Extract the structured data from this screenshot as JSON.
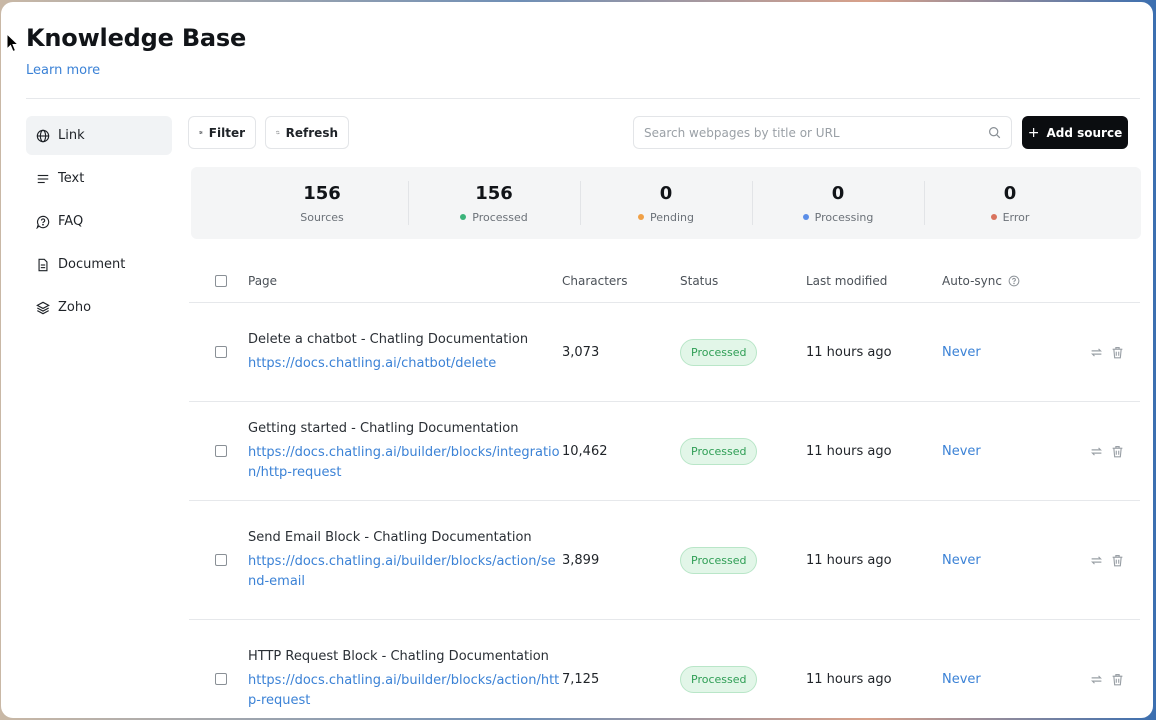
{
  "header": {
    "title": "Knowledge Base",
    "learn_more": "Learn more"
  },
  "sidebar": {
    "items": [
      {
        "label": "Link",
        "icon": "globe-icon",
        "active": true
      },
      {
        "label": "Text",
        "icon": "text-lines-icon"
      },
      {
        "label": "FAQ",
        "icon": "help-chat-icon"
      },
      {
        "label": "Document",
        "icon": "document-icon"
      },
      {
        "label": "Zoho",
        "icon": "layers-icon"
      }
    ]
  },
  "toolbar": {
    "filter_label": "Filter",
    "refresh_label": "Refresh",
    "search_placeholder": "Search webpages by title or URL",
    "add_source_label": "Add source"
  },
  "stats": [
    {
      "value": "156",
      "label": "Sources"
    },
    {
      "value": "156",
      "label": "Processed",
      "color": "#3bb37a"
    },
    {
      "value": "0",
      "label": "Pending",
      "color": "#f0a046"
    },
    {
      "value": "0",
      "label": "Processing",
      "color": "#5b8ee8"
    },
    {
      "value": "0",
      "label": "Error",
      "color": "#d9735e"
    }
  ],
  "table": {
    "columns": {
      "page": "Page",
      "characters": "Characters",
      "status": "Status",
      "last_modified": "Last modified",
      "auto_sync": "Auto-sync"
    },
    "rows": [
      {
        "title": "Delete a chatbot - Chatling Documentation",
        "url": "https://docs.chatling.ai/chatbot/delete",
        "characters": "3,073",
        "status": "Processed",
        "last_modified": "11 hours ago",
        "auto_sync": "Never"
      },
      {
        "title": "Getting started - Chatling Documentation",
        "url": "https://docs.chatling.ai/builder/blocks/integration/http-request",
        "characters": "10,462",
        "status": "Processed",
        "last_modified": "11 hours ago",
        "auto_sync": "Never"
      },
      {
        "title": "Send Email Block - Chatling Documentation",
        "url": "https://docs.chatling.ai/builder/blocks/action/send-email",
        "characters": "3,899",
        "status": "Processed",
        "last_modified": "11 hours ago",
        "auto_sync": "Never"
      },
      {
        "title": "HTTP Request Block - Chatling Documentation",
        "url": "https://docs.chatling.ai/builder/blocks/action/http-request",
        "characters": "7,125",
        "status": "Processed",
        "last_modified": "11 hours ago",
        "auto_sync": "Never"
      }
    ]
  }
}
